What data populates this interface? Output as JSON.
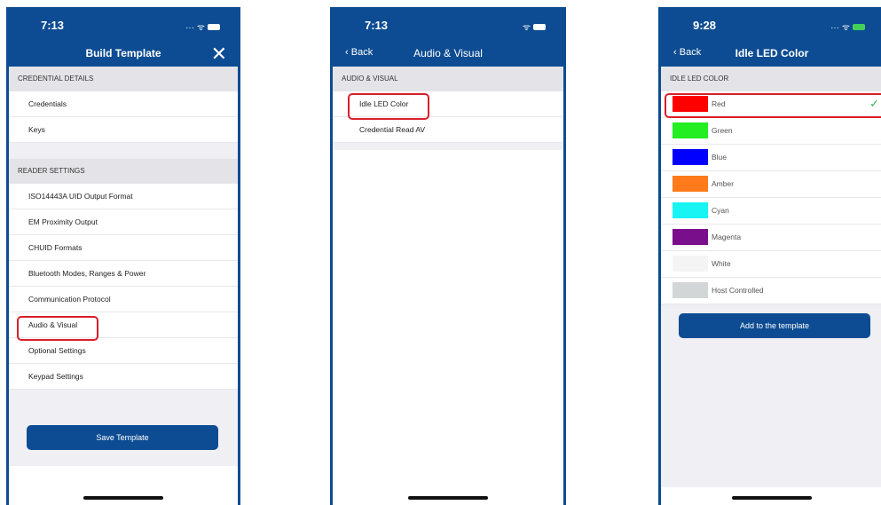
{
  "screen1": {
    "time": "7:13",
    "title": "Build Template",
    "close_glyph": "✕",
    "section_credential": "CREDENTIAL DETAILS",
    "credential_rows": [
      "Credentials",
      "Keys"
    ],
    "section_reader": "READER SETTINGS",
    "reader_rows": [
      "ISO14443A UID Output Format",
      "EM Proximity Output",
      "CHUID Formats",
      "Bluetooth Modes, Ranges & Power",
      "Communication Protocol",
      "Audio & Visual",
      "Optional Settings",
      "Keypad Settings"
    ],
    "save_button": "Save Template"
  },
  "screen2": {
    "time": "7:13",
    "back": "Back",
    "title": "Audio & Visual",
    "section": "AUDIO & VISUAL",
    "rows": [
      "Idle LED Color",
      "Credential Read AV"
    ]
  },
  "screen3": {
    "time": "9:28",
    "back": "Back",
    "title": "Idle LED Color",
    "section": "IDLE LED COLOR",
    "colors": [
      {
        "label": "Red",
        "color": "#ff0000"
      },
      {
        "label": "Green",
        "color": "#22ee22"
      },
      {
        "label": "Blue",
        "color": "#0000ff"
      },
      {
        "label": "Amber",
        "color": "#ff7a1a"
      },
      {
        "label": "Cyan",
        "color": "#18f4f4"
      },
      {
        "label": "Magenta",
        "color": "#7a0f8c"
      },
      {
        "label": "White",
        "color": "#f4f4f4"
      },
      {
        "label": "Host Controlled",
        "color": "#d3d6d6"
      }
    ],
    "add_button": "Add to the template"
  },
  "theme": {
    "accent": "#0d4c92",
    "highlight": "#d81f2a",
    "check": "#2fbb52"
  }
}
